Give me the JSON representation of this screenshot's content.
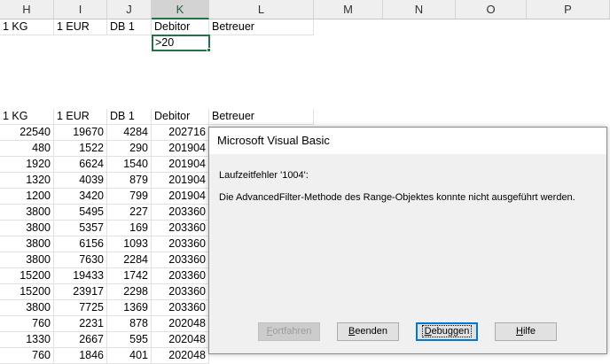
{
  "columns": [
    "H",
    "I",
    "J",
    "K",
    "L",
    "M",
    "N",
    "O",
    "P"
  ],
  "selected_column": "K",
  "criteria_headers": [
    "1 KG",
    "1 EUR",
    "DB 1",
    "Debitor",
    "Betreuer"
  ],
  "criteria_value": ">20",
  "data_headers": [
    "1 KG",
    "1 EUR",
    "DB 1",
    "Debitor",
    "Betreuer"
  ],
  "rows": [
    [
      "22540",
      "19670",
      "4284",
      "202716"
    ],
    [
      "480",
      "1522",
      "290",
      "201904"
    ],
    [
      "1920",
      "6624",
      "1540",
      "201904"
    ],
    [
      "1320",
      "4039",
      "879",
      "201904"
    ],
    [
      "1200",
      "3420",
      "799",
      "201904"
    ],
    [
      "3800",
      "5495",
      "227",
      "203360"
    ],
    [
      "3800",
      "5357",
      "169",
      "203360"
    ],
    [
      "3800",
      "6156",
      "1093",
      "203360"
    ],
    [
      "3800",
      "7630",
      "2284",
      "203360"
    ],
    [
      "15200",
      "19433",
      "1742",
      "203360"
    ],
    [
      "15200",
      "23917",
      "2298",
      "203360"
    ],
    [
      "3800",
      "7725",
      "1369",
      "203360"
    ],
    [
      "760",
      "2231",
      "878",
      "202048"
    ],
    [
      "1330",
      "2667",
      "595",
      "202048"
    ],
    [
      "760",
      "1846",
      "401",
      "202048"
    ]
  ],
  "dialog": {
    "title": "Microsoft Visual Basic",
    "error_line": "Laufzeitfehler '1004':",
    "message": "Die AdvancedFilter-Methode des Range-Objektes konnte nicht ausgeführt werden.",
    "buttons": {
      "continue": {
        "mnemonic": "F",
        "rest": "ortfahren"
      },
      "end": {
        "mnemonic": "B",
        "rest": "eenden"
      },
      "debug": {
        "mnemonic": "D",
        "rest": "ebuggen"
      },
      "help": {
        "mnemonic": "H",
        "rest": "ilfe"
      }
    }
  },
  "colors": {
    "selection_green": "#217346",
    "dialog_focus_blue": "#0078d7"
  }
}
